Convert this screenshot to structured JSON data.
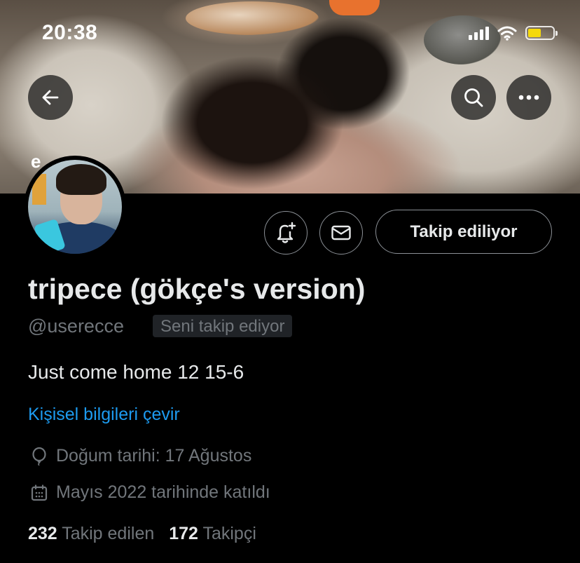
{
  "status_bar": {
    "time": "20:38",
    "icons": [
      "signal-icon",
      "wifi-icon",
      "battery-charging-icon"
    ]
  },
  "header": {
    "back_icon": "arrow-left-icon",
    "search_icon": "search-icon",
    "more_icon": "more-horizontal-icon"
  },
  "banner": {
    "badge_text": "e"
  },
  "actions": {
    "notify_icon": "bell-plus-icon",
    "message_icon": "envelope-icon",
    "follow_label": "Takip ediliyor"
  },
  "profile": {
    "display_name": "tripece (gökçe's version)",
    "handle": "@userecce",
    "follows_you": "Seni takip ediyor",
    "bio": "Just come home 12 15-6",
    "translate_link": "Kişisel bilgileri çevir",
    "birthday": "Doğum tarihi: 17 Ağustos",
    "joined": "Mayıs 2022 tarihinde katıldı",
    "following_count": "232",
    "following_label": "Takip edilen",
    "followers_count": "172",
    "followers_label": "Takipçi"
  },
  "colors": {
    "background": "#000000",
    "text_primary": "#e7e9ea",
    "text_secondary": "#71767b",
    "link": "#1d9bf0",
    "battery": "#f5d90a"
  }
}
